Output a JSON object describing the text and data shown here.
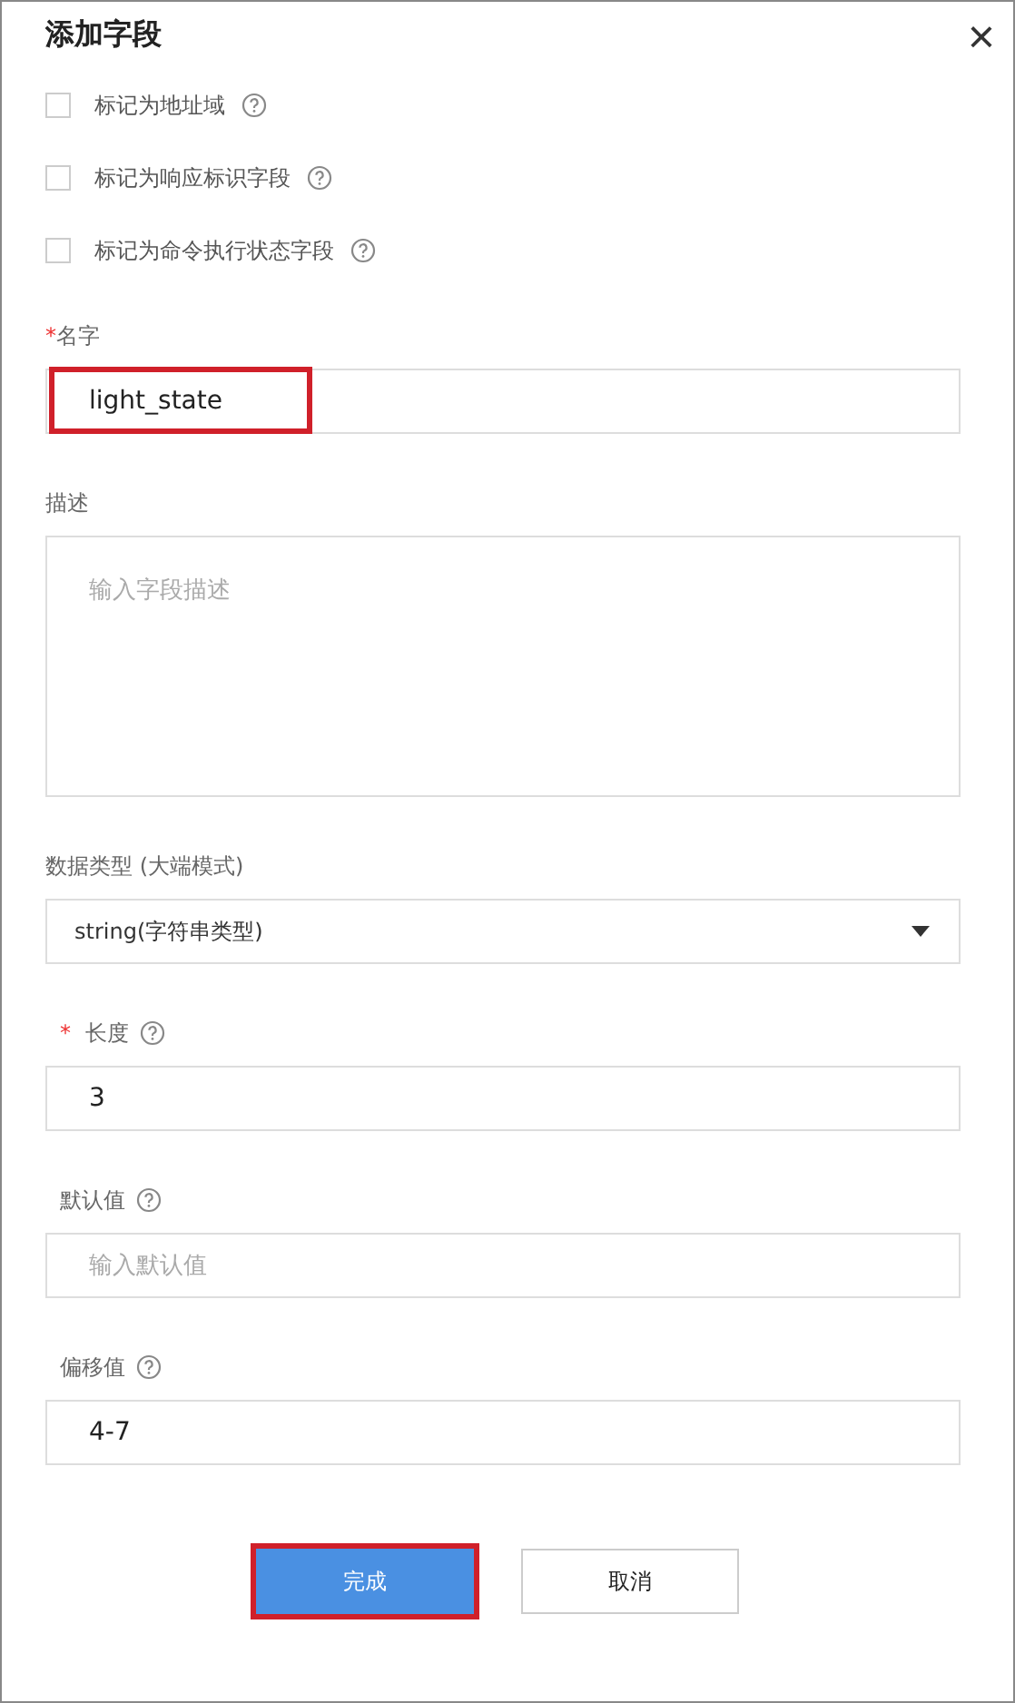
{
  "dialog": {
    "title": "添加字段",
    "close": "×"
  },
  "checkboxes": [
    {
      "label": "标记为地址域",
      "checked": false,
      "help": true
    },
    {
      "label": "标记为响应标识字段",
      "checked": false,
      "help": true
    },
    {
      "label": "标记为命令执行状态字段",
      "checked": false,
      "help": true
    }
  ],
  "fields": [
    {
      "kind": "text",
      "label": "名字",
      "required_mark": "*",
      "indent": false,
      "help": false,
      "value": "light_state",
      "highlighted": true
    },
    {
      "kind": "textarea",
      "label": "描述",
      "indent": false,
      "help": false,
      "placeholder": "输入字段描述",
      "highlighted": false
    },
    {
      "kind": "select",
      "label": "数据类型 (大端模式)",
      "indent": false,
      "help": false,
      "value": "string(字符串类型)",
      "highlighted": false
    },
    {
      "kind": "text",
      "label": "长度",
      "required_mark": "*",
      "indent": true,
      "help": true,
      "value": "3",
      "highlighted": false
    },
    {
      "kind": "text",
      "label": "默认值",
      "indent": true,
      "help": true,
      "placeholder": "输入默认值",
      "highlighted": false
    },
    {
      "kind": "text",
      "label": "偏移值",
      "indent": true,
      "help": true,
      "value": "4-7",
      "highlighted": false
    }
  ],
  "buttons": [
    {
      "label": "完成",
      "kind": "primary",
      "highlighted": true
    },
    {
      "label": "取消",
      "kind": "secondary",
      "highlighted": false
    }
  ]
}
